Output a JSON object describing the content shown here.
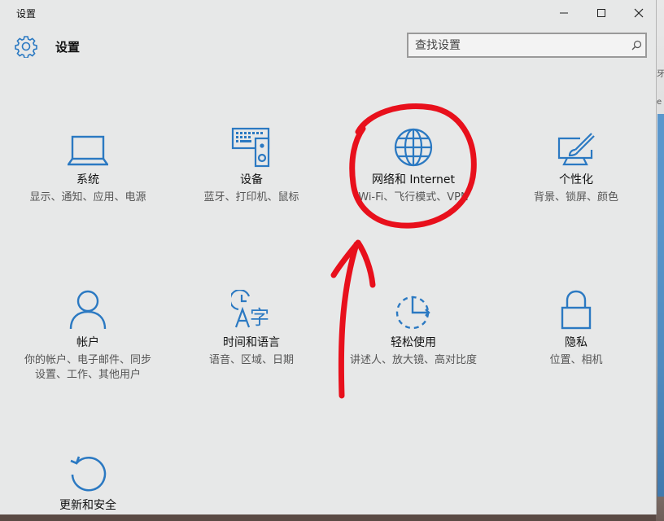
{
  "window": {
    "title": "设置"
  },
  "header": {
    "app_title": "设置",
    "search_placeholder": "查找设置"
  },
  "background": {
    "edge_text_1": "牙",
    "edge_text_2": "e"
  },
  "tiles": [
    {
      "name": "系统",
      "desc": "显示、通知、应用、电源",
      "icon": "monitor-icon"
    },
    {
      "name": "设备",
      "desc": "蓝牙、打印机、鼠标",
      "icon": "devices-icon"
    },
    {
      "name": "网络和 Internet",
      "desc": "Wi-Fi、飞行模式、VPN",
      "icon": "globe-icon"
    },
    {
      "name": "个性化",
      "desc": "背景、锁屏、颜色",
      "icon": "paint-icon"
    },
    {
      "name": "帐户",
      "desc": "你的帐户、电子邮件、同步设置、工作、其他用户",
      "icon": "person-icon"
    },
    {
      "name": "时间和语言",
      "desc": "语音、区域、日期",
      "icon": "time-language-icon"
    },
    {
      "name": "轻松使用",
      "desc": "讲述人、放大镜、高对比度",
      "icon": "ease-of-access-icon"
    },
    {
      "name": "隐私",
      "desc": "位置、相机",
      "icon": "lock-icon"
    },
    {
      "name": "更新和安全",
      "desc": "",
      "icon": "update-icon"
    }
  ],
  "colors": {
    "accent": "#2b79c2",
    "window_bg": "#e7e8e8",
    "annotation_red": "#e8101c"
  }
}
